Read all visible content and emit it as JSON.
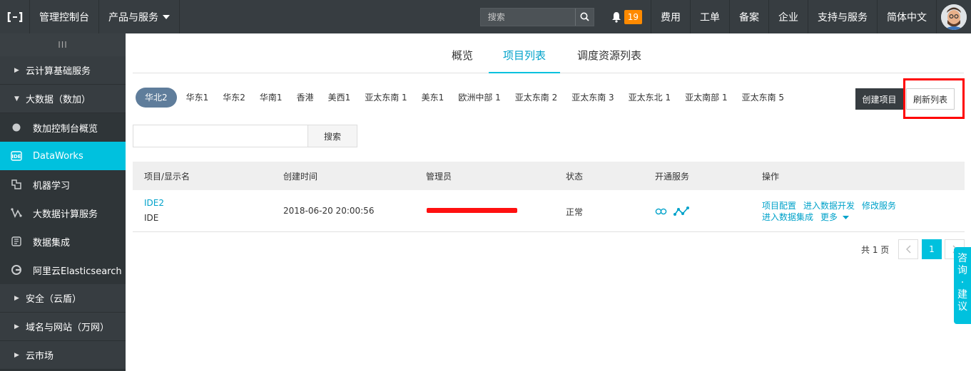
{
  "topbar": {
    "console": "管理控制台",
    "products": "产品与服务",
    "search_placeholder": "搜索",
    "notifications": "19",
    "links": [
      "费用",
      "工单",
      "备案",
      "企业",
      "支持与服务",
      "简体中文"
    ]
  },
  "sidebar": {
    "handle": "III",
    "items": [
      {
        "type": "group",
        "label": "云计算基础服务",
        "arrow": "▶"
      },
      {
        "type": "group",
        "label": "大数据（数加）",
        "arrow": "▼"
      },
      {
        "type": "sub",
        "label": "数加控制台概览",
        "icon": "circle-icon"
      },
      {
        "type": "sub",
        "label": "DataWorks",
        "icon": "ide-icon",
        "active": true
      },
      {
        "type": "sub",
        "label": "机器学习",
        "icon": "ml-icon"
      },
      {
        "type": "sub",
        "label": "大数据计算服务",
        "icon": "compute-icon"
      },
      {
        "type": "sub",
        "label": "数据集成",
        "icon": "integration-icon"
      },
      {
        "type": "sub",
        "label": "阿里云Elasticsearch",
        "icon": "elasticsearch-icon"
      },
      {
        "type": "group",
        "label": "安全（云盾）",
        "arrow": "▶"
      },
      {
        "type": "group",
        "label": "域名与网站（万网）",
        "arrow": "▶"
      },
      {
        "type": "group",
        "label": "云市场",
        "arrow": "▶"
      }
    ]
  },
  "tabs": {
    "overview": "概览",
    "projects": "项目列表",
    "resources": "调度资源列表"
  },
  "regions": [
    "华北2",
    "华东1",
    "华东2",
    "华南1",
    "香港",
    "美西1",
    "亚太东南 1",
    "美东1",
    "欧洲中部 1",
    "亚太东南 2",
    "亚太东南 3",
    "亚太东北 1",
    "亚太南部 1",
    "亚太东南 5"
  ],
  "actions": {
    "create": "创建项目",
    "refresh": "刷新列表"
  },
  "search": {
    "value": "",
    "button": "搜索"
  },
  "table": {
    "headers": [
      "项目/显示名",
      "创建时间",
      "管理员",
      "状态",
      "开通服务",
      "操作"
    ],
    "rows": [
      {
        "project": "IDE2",
        "display": "IDE",
        "created": "2018-06-20 20:00:56",
        "status": "正常",
        "ops": [
          "项目配置",
          "进入数据开发",
          "修改服务",
          "进入数据集成",
          "更多"
        ]
      }
    ]
  },
  "pager": {
    "total": "共 1 页",
    "current": "1"
  },
  "consult": [
    "咨",
    "询",
    "·",
    "建",
    "议"
  ],
  "colors": {
    "accent": "#00c1de",
    "topbar": "#373d41",
    "sidebar": "#2f3538",
    "highlight": "#ff0000",
    "badge": "#ff8a00"
  }
}
